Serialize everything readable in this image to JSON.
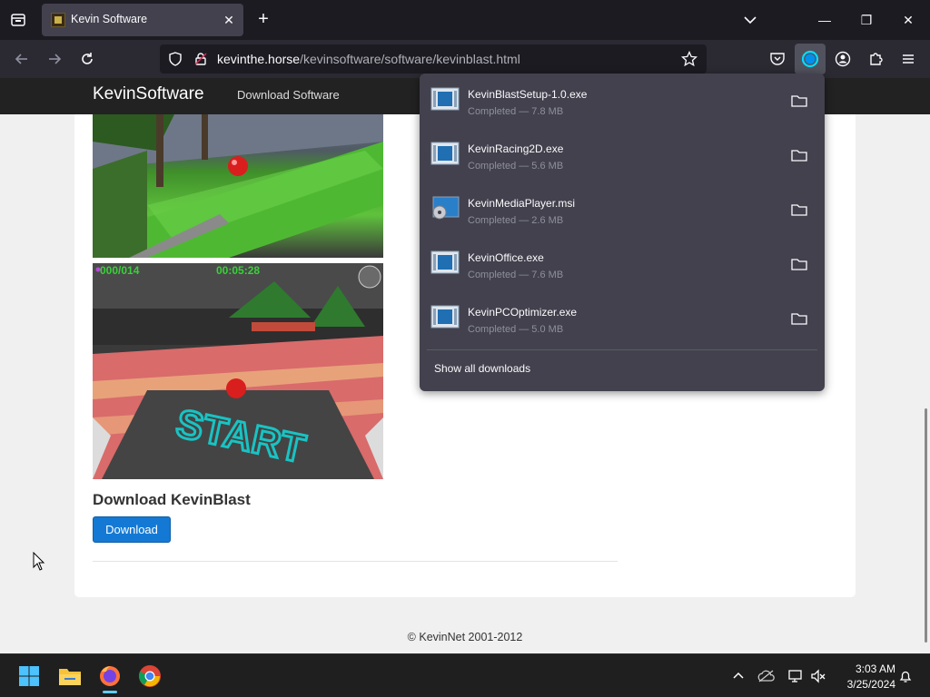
{
  "browser": {
    "tab_title": "Kevin Software",
    "url_domain": "kevinthe.horse",
    "url_path": "/kevinsoftware/software/kevinblast.html"
  },
  "site": {
    "brand": "KevinSoftware",
    "nav_download": "Download Software",
    "heading": "Download KevinBlast",
    "download_button": "Download",
    "footer": "© KevinNet 2001-2012",
    "game_hud_counter": "000/014",
    "game_hud_timer": "00:05:28",
    "start_text": "START"
  },
  "downloads": {
    "items": [
      {
        "name": "KevinBlastSetup-1.0.exe",
        "status": "Completed — 7.8 MB",
        "icon": "exe-icon"
      },
      {
        "name": "KevinRacing2D.exe",
        "status": "Completed — 5.6 MB",
        "icon": "exe-icon"
      },
      {
        "name": "KevinMediaPlayer.msi",
        "status": "Completed — 2.6 MB",
        "icon": "msi-icon"
      },
      {
        "name": "KevinOffice.exe",
        "status": "Completed — 7.6 MB",
        "icon": "exe-icon"
      },
      {
        "name": "KevinPCOptimizer.exe",
        "status": "Completed — 5.0 MB",
        "icon": "exe-icon"
      }
    ],
    "show_all": "Show all downloads"
  },
  "taskbar": {
    "time": "3:03 AM",
    "date": "3/25/2024"
  },
  "colors": {
    "accent_blue": "#1479d4",
    "panel_bg": "#42414d",
    "toolbar_bg": "#2b2a33"
  }
}
